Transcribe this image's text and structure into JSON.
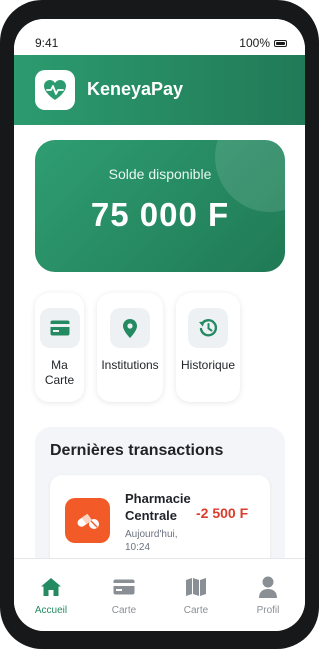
{
  "status_bar": {
    "time": "9:41",
    "battery": "100%"
  },
  "app": {
    "name": "KeneyaPay",
    "logo_icon": "heart-pulse-icon"
  },
  "balance": {
    "label": "Solde disponible",
    "amount": "75 000 F"
  },
  "quick_actions": [
    {
      "label": "Ma Carte",
      "icon": "credit-card-icon"
    },
    {
      "label": "Institutions",
      "icon": "location-pin-icon"
    },
    {
      "label": "Historique",
      "icon": "history-icon"
    }
  ],
  "transactions": {
    "title": "Dernières transactions",
    "items": [
      {
        "name": "Pharmacie Centrale",
        "date": "Aujourd'hui, 10:24",
        "amount": "-2 500 F",
        "icon": "pills-icon"
      }
    ]
  },
  "bottom_nav": [
    {
      "label": "Accueil",
      "icon": "home-icon",
      "active": true
    },
    {
      "label": "Carte",
      "icon": "credit-card-icon",
      "active": false
    },
    {
      "label": "Carte",
      "icon": "map-icon",
      "active": false
    },
    {
      "label": "Profil",
      "icon": "user-icon",
      "active": false
    }
  ],
  "colors": {
    "primary": "#248A61",
    "accent_debit": "#D93D2B",
    "pharmacy": "#F25A28"
  }
}
